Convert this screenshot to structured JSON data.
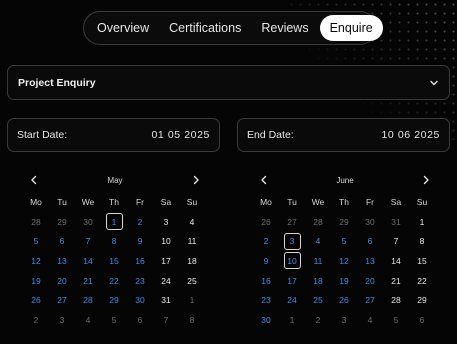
{
  "tabs": [
    {
      "label": "Overview",
      "active": false
    },
    {
      "label": "Certifications",
      "active": false
    },
    {
      "label": "Reviews",
      "active": false
    },
    {
      "label": "Enquire",
      "active": true
    }
  ],
  "enquiry_select": {
    "value": "Project Enquiry",
    "icon": "chevron-down-icon"
  },
  "start_date": {
    "label": "Start Date:",
    "value": "01 05 2025"
  },
  "end_date": {
    "label": "End Date:",
    "value": "10 06 2025"
  },
  "colors": {
    "range": "#3b8ee8",
    "muted": "#6d6d6d",
    "text": "#e8e8e8",
    "background": "#050505"
  },
  "calendars": [
    {
      "month": "May",
      "weekdays": [
        "Mo",
        "Tu",
        "We",
        "Th",
        "Fr",
        "Sa",
        "Su"
      ],
      "days": [
        {
          "d": "28",
          "s": "muted"
        },
        {
          "d": "29",
          "s": "muted"
        },
        {
          "d": "30",
          "s": "muted"
        },
        {
          "d": "1",
          "s": "sel"
        },
        {
          "d": "2",
          "s": "range"
        },
        {
          "d": "3",
          "s": "normal"
        },
        {
          "d": "4",
          "s": "normal"
        },
        {
          "d": "5",
          "s": "range"
        },
        {
          "d": "6",
          "s": "range"
        },
        {
          "d": "7",
          "s": "range"
        },
        {
          "d": "8",
          "s": "range"
        },
        {
          "d": "9",
          "s": "range"
        },
        {
          "d": "10",
          "s": "normal"
        },
        {
          "d": "11",
          "s": "normal"
        },
        {
          "d": "12",
          "s": "range"
        },
        {
          "d": "13",
          "s": "range"
        },
        {
          "d": "14",
          "s": "range"
        },
        {
          "d": "15",
          "s": "range"
        },
        {
          "d": "16",
          "s": "range"
        },
        {
          "d": "17",
          "s": "normal"
        },
        {
          "d": "18",
          "s": "normal"
        },
        {
          "d": "19",
          "s": "range"
        },
        {
          "d": "20",
          "s": "range"
        },
        {
          "d": "21",
          "s": "range"
        },
        {
          "d": "22",
          "s": "range"
        },
        {
          "d": "23",
          "s": "range"
        },
        {
          "d": "24",
          "s": "normal"
        },
        {
          "d": "25",
          "s": "normal"
        },
        {
          "d": "26",
          "s": "range"
        },
        {
          "d": "27",
          "s": "range"
        },
        {
          "d": "28",
          "s": "range"
        },
        {
          "d": "29",
          "s": "range"
        },
        {
          "d": "30",
          "s": "range"
        },
        {
          "d": "31",
          "s": "normal"
        },
        {
          "d": "1",
          "s": "muted"
        },
        {
          "d": "2",
          "s": "muted"
        },
        {
          "d": "3",
          "s": "muted"
        },
        {
          "d": "4",
          "s": "muted"
        },
        {
          "d": "5",
          "s": "muted"
        },
        {
          "d": "6",
          "s": "muted"
        },
        {
          "d": "7",
          "s": "muted"
        },
        {
          "d": "8",
          "s": "muted"
        }
      ]
    },
    {
      "month": "June",
      "weekdays": [
        "Mo",
        "Tu",
        "We",
        "Th",
        "Fr",
        "Sa",
        "Su"
      ],
      "days": [
        {
          "d": "26",
          "s": "muted"
        },
        {
          "d": "27",
          "s": "muted"
        },
        {
          "d": "28",
          "s": "muted"
        },
        {
          "d": "29",
          "s": "muted"
        },
        {
          "d": "30",
          "s": "muted"
        },
        {
          "d": "31",
          "s": "muted"
        },
        {
          "d": "1",
          "s": "normal"
        },
        {
          "d": "2",
          "s": "range"
        },
        {
          "d": "3",
          "s": "sel"
        },
        {
          "d": "4",
          "s": "range"
        },
        {
          "d": "5",
          "s": "range"
        },
        {
          "d": "6",
          "s": "range"
        },
        {
          "d": "7",
          "s": "normal"
        },
        {
          "d": "8",
          "s": "normal"
        },
        {
          "d": "9",
          "s": "range"
        },
        {
          "d": "10",
          "s": "sel"
        },
        {
          "d": "11",
          "s": "range"
        },
        {
          "d": "12",
          "s": "range"
        },
        {
          "d": "13",
          "s": "range"
        },
        {
          "d": "14",
          "s": "normal"
        },
        {
          "d": "15",
          "s": "normal"
        },
        {
          "d": "16",
          "s": "range"
        },
        {
          "d": "17",
          "s": "range"
        },
        {
          "d": "18",
          "s": "range"
        },
        {
          "d": "19",
          "s": "range"
        },
        {
          "d": "20",
          "s": "range"
        },
        {
          "d": "21",
          "s": "normal"
        },
        {
          "d": "22",
          "s": "normal"
        },
        {
          "d": "23",
          "s": "range"
        },
        {
          "d": "24",
          "s": "range"
        },
        {
          "d": "25",
          "s": "range"
        },
        {
          "d": "26",
          "s": "range"
        },
        {
          "d": "27",
          "s": "range"
        },
        {
          "d": "28",
          "s": "normal"
        },
        {
          "d": "29",
          "s": "normal"
        },
        {
          "d": "30",
          "s": "range"
        },
        {
          "d": "1",
          "s": "muted"
        },
        {
          "d": "2",
          "s": "muted"
        },
        {
          "d": "3",
          "s": "muted"
        },
        {
          "d": "4",
          "s": "muted"
        },
        {
          "d": "5",
          "s": "muted"
        },
        {
          "d": "6",
          "s": "muted"
        }
      ]
    }
  ]
}
